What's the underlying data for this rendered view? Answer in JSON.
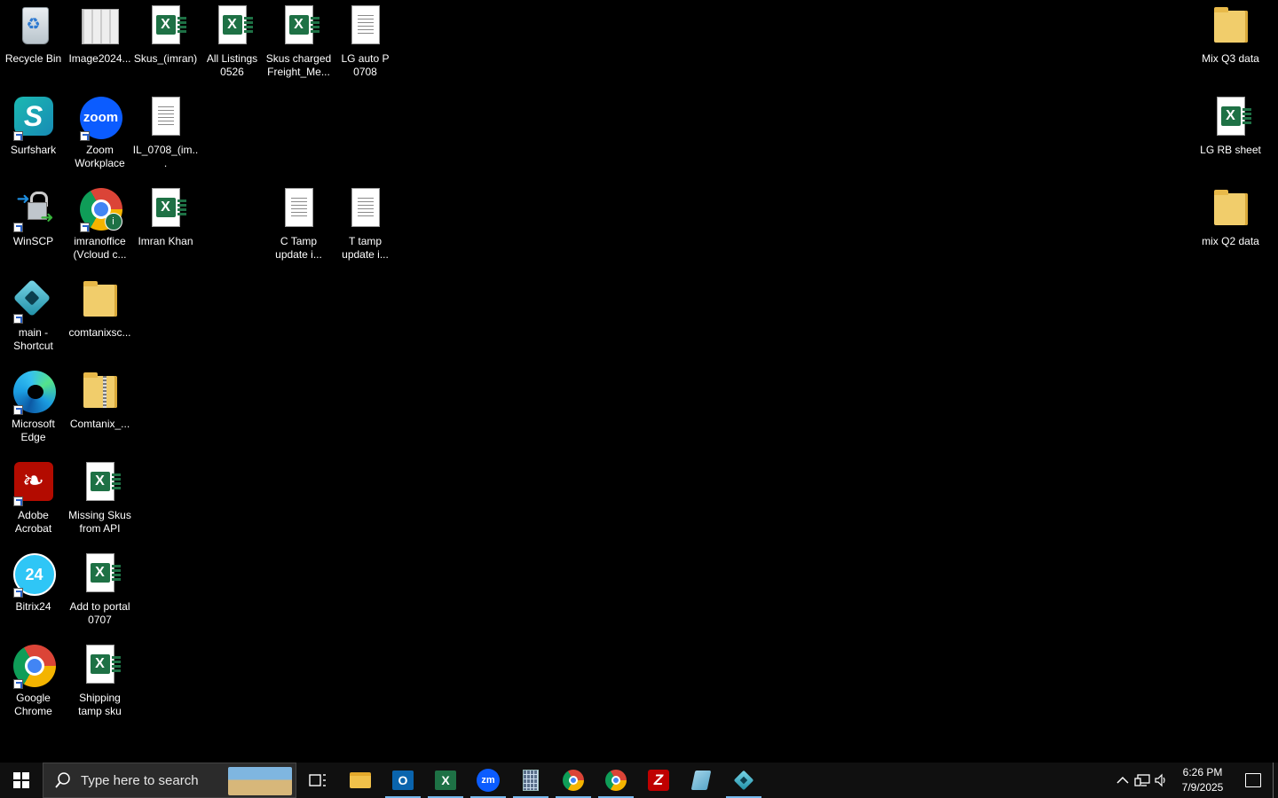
{
  "desktop": {
    "icons": [
      {
        "label": "Recycle Bin"
      },
      {
        "label": "Image2024..."
      },
      {
        "label": "Skus_(imran)"
      },
      {
        "label": "All Listings 0526"
      },
      {
        "label": "Skus charged Freight_Me..."
      },
      {
        "label": "LG auto P 0708"
      },
      {
        "label": "Surfshark"
      },
      {
        "label": "Zoom Workplace"
      },
      {
        "label": "IL_0708_(im..."
      },
      {
        "label": "WinSCP"
      },
      {
        "label": "imranoffice (Vcloud c..."
      },
      {
        "label": "Imran Khan"
      },
      {
        "label": "C Tamp update i..."
      },
      {
        "label": "T tamp update i..."
      },
      {
        "label": "main - Shortcut"
      },
      {
        "label": "comtanixsc..."
      },
      {
        "label": "Microsoft Edge"
      },
      {
        "label": "Comtanix_..."
      },
      {
        "label": "Adobe Acrobat"
      },
      {
        "label": "Missing Skus from API"
      },
      {
        "label": "Bitrix24"
      },
      {
        "label": "Add to portal 0707"
      },
      {
        "label": "Google Chrome"
      },
      {
        "label": "Shipping tamp sku"
      },
      {
        "label": "Mix Q3 data"
      },
      {
        "label": "LG RB sheet"
      },
      {
        "label": "mix Q2 data"
      }
    ],
    "icon_text": {
      "zoom": "zoom",
      "bitrix": "24",
      "excel_letter": "X",
      "chrome_badge": "i"
    }
  },
  "taskbar": {
    "search_placeholder": "Type here to search",
    "apps": [
      "file-explorer",
      "outlook",
      "excel",
      "zoom",
      "calculator",
      "chrome",
      "chrome",
      "filezilla",
      "notepad",
      "main"
    ],
    "app_text": {
      "outlook": "O",
      "excel": "X",
      "zoom": "zm",
      "filezilla": "Z"
    },
    "tray": {
      "time": "6:26 PM",
      "date": "7/9/2025"
    }
  },
  "colors": {
    "background": "#000000",
    "excel_green": "#1e7145",
    "folder_yellow": "#f1cd6b",
    "taskbar": "#101010",
    "active_indicator": "#76b9ed"
  }
}
